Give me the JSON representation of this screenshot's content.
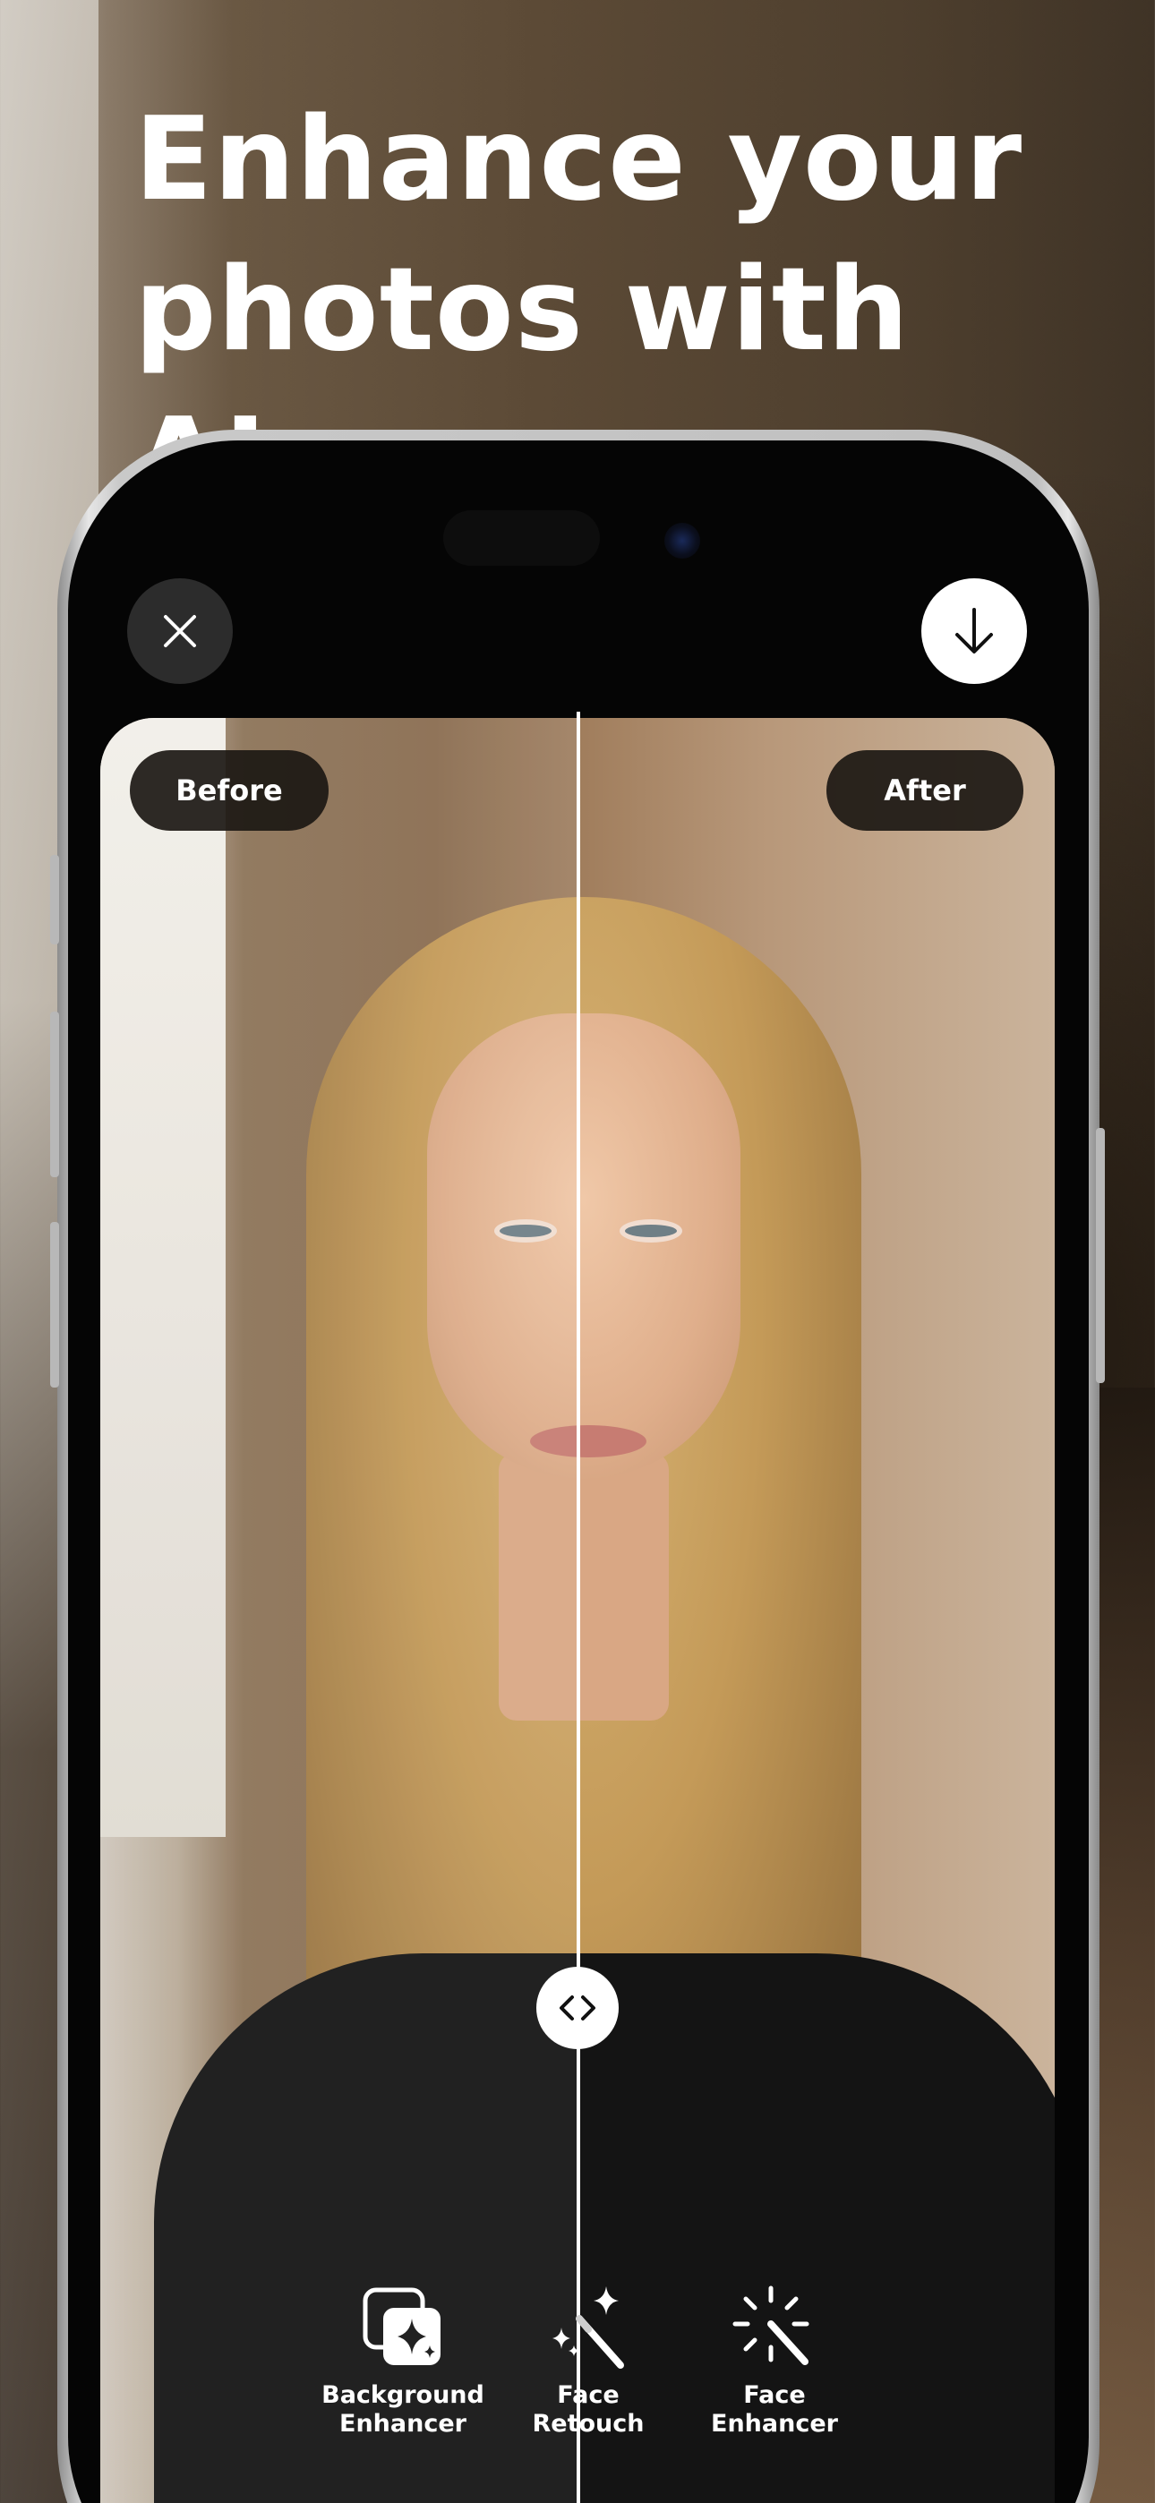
{
  "headline": {
    "line1": "Enhance your",
    "line2": "photos with AI"
  },
  "toolbar": {
    "close_icon": "close-icon",
    "download_icon": "download-icon"
  },
  "comparison": {
    "before_label": "Before",
    "after_label": "After",
    "handle_icon": "left-right-chevrons-icon",
    "split_position": 0.5
  },
  "tools": [
    {
      "line1": "Background",
      "line2": "Enhancer",
      "icon": "background-sparkle-icon"
    },
    {
      "line1": "Face",
      "line2": "Retouch",
      "icon": "magic-wand-icon"
    },
    {
      "line1": "Face",
      "line2": "Enhancer",
      "icon": "magic-wand-burst-icon"
    }
  ],
  "colors": {
    "headline": "#ffffff",
    "pill_bg": "#1c1814",
    "download_bg": "#ffffff",
    "close_bg": "#2c2c2c"
  }
}
